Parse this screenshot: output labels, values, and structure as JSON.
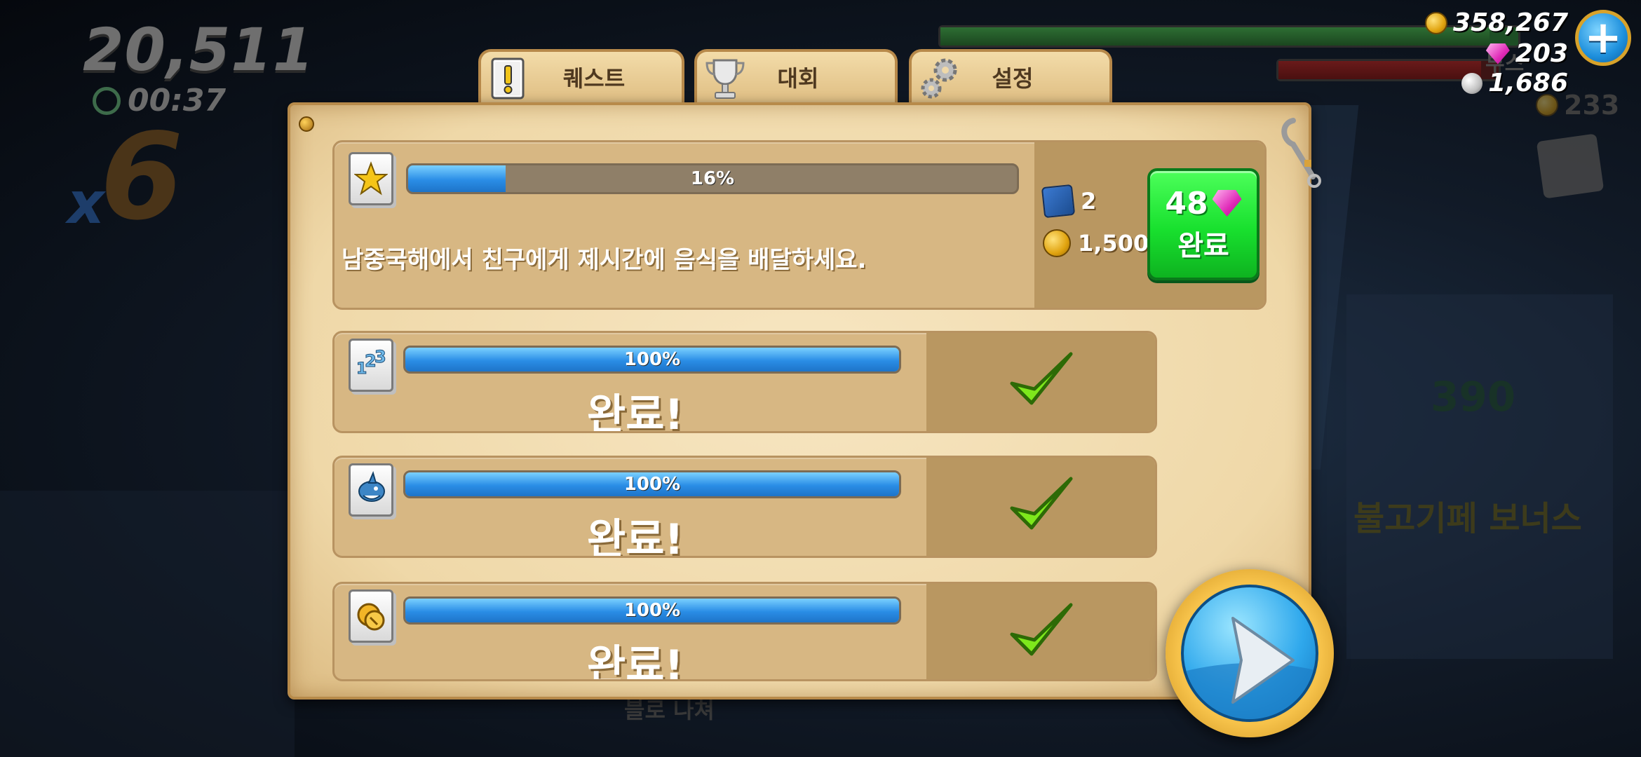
{
  "hud": {
    "score": "20,511",
    "timer": "00:37",
    "multiplier_x": "x",
    "multiplier_value": "6",
    "boost_label": "부스",
    "coins": "358,267",
    "gems": "203",
    "pearls": "1,686",
    "secondary_coins": "233",
    "plus_symbol": "+"
  },
  "background_text": {
    "bonus": "불고기페 보너스",
    "number": "390",
    "bottom_label": "블로 나쳐"
  },
  "tabs": [
    {
      "label": "퀘스트",
      "icon": "quest-scroll-icon",
      "active": true
    },
    {
      "label": "대회",
      "icon": "trophy-icon",
      "active": false
    },
    {
      "label": "설정",
      "icon": "gears-icon",
      "active": false
    }
  ],
  "active_quest": {
    "icon": "starfish-icon",
    "progress": 16,
    "progress_text": "16%",
    "description": "남중국해에서 친구에게 제시간에 음식을 배달하세요.",
    "reward_scroll_count": "2",
    "reward_coins": "1,500",
    "complete_cost": "48",
    "complete_label": "완료"
  },
  "completed_quests": [
    {
      "icon": "numbers-icon",
      "progress": 100,
      "progress_text": "100%",
      "status": "완료!"
    },
    {
      "icon": "shark-icon",
      "progress": 100,
      "progress_text": "100%",
      "status": "완료!"
    },
    {
      "icon": "coins-icon",
      "progress": 100,
      "progress_text": "100%",
      "status": "완료!"
    }
  ],
  "colors": {
    "panel": "#efd8a8",
    "progress_blue": "#2a8de6",
    "complete_green": "#18e02e",
    "check_green": "#7ee81c"
  }
}
